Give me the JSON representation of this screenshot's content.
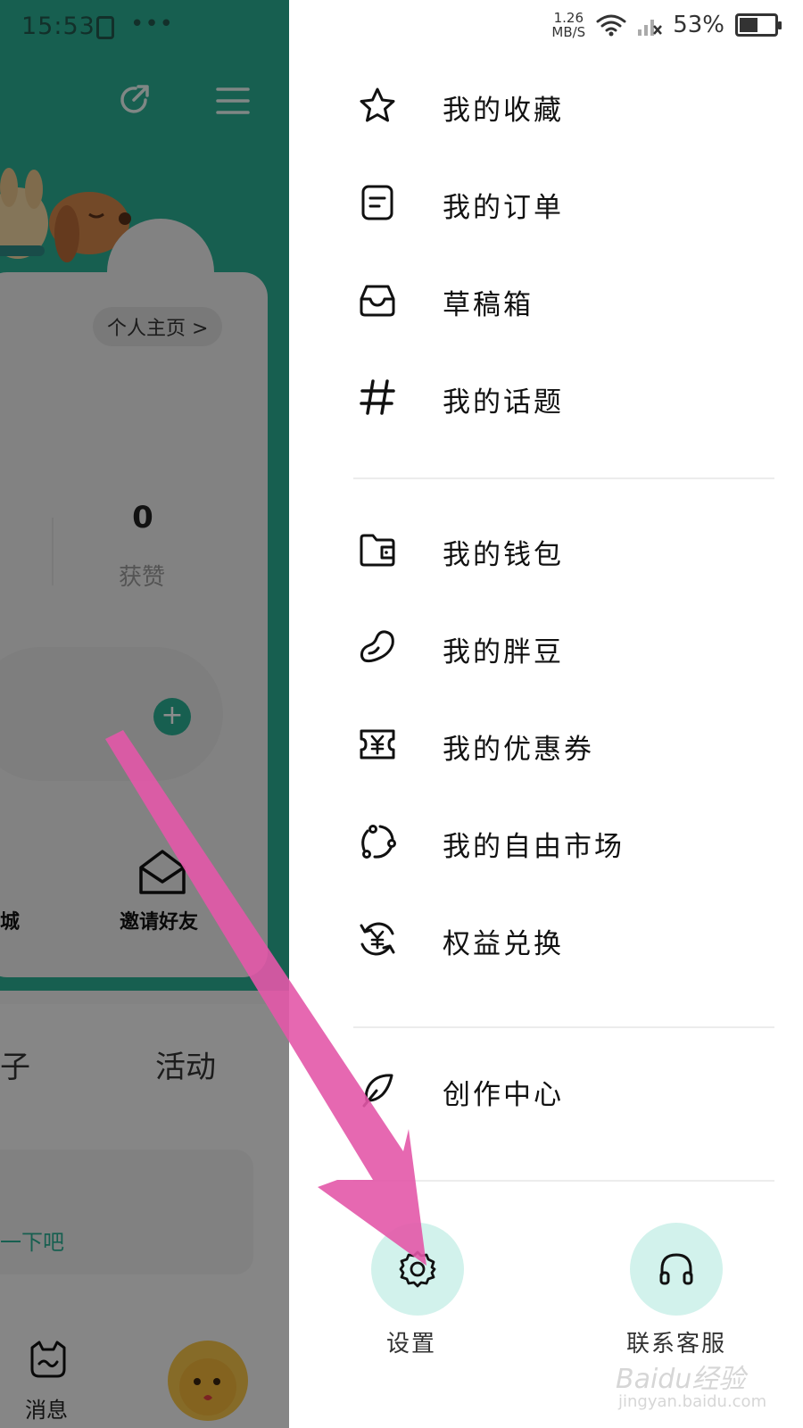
{
  "colors": {
    "accent": "#2bae92",
    "bottom_button_bg": "#d2f2ec",
    "arrow": "#e358a8",
    "text_primary": "#111111"
  },
  "status_bar": {
    "time": "15:53",
    "net_speed_value": "1.26",
    "net_speed_unit": "MB/S",
    "battery_percent": "53%",
    "battery_level": 0.53
  },
  "background": {
    "profile_link": "个人主页 >",
    "stat_value": "0",
    "stat_label": "获赞",
    "grid_label_1": "城",
    "grid_label_2": "邀请好友",
    "tab_1": "子",
    "tab_2": "活动",
    "empty_link": "一下吧",
    "bottom_nav_label": "消息"
  },
  "drawer": {
    "menu_group_1": [
      {
        "label": "我的收藏",
        "icon": "star-icon"
      },
      {
        "label": "我的订单",
        "icon": "order-icon"
      },
      {
        "label": "草稿箱",
        "icon": "inbox-icon"
      },
      {
        "label": "我的话题",
        "icon": "hashtag-icon"
      }
    ],
    "menu_group_2": [
      {
        "label": "我的钱包",
        "icon": "wallet-icon"
      },
      {
        "label": "我的胖豆",
        "icon": "bean-icon"
      },
      {
        "label": "我的优惠券",
        "icon": "coupon-icon"
      },
      {
        "label": "我的自由市场",
        "icon": "market-icon"
      },
      {
        "label": "权益兑换",
        "icon": "exchange-icon"
      }
    ],
    "menu_group_3": [
      {
        "label": "创作中心",
        "icon": "feather-icon"
      }
    ],
    "bottom": {
      "settings_label": "设置",
      "support_label": "联系客服"
    }
  },
  "watermark": {
    "brand": "Baidu经验",
    "url": "jingyan.baidu.com"
  }
}
